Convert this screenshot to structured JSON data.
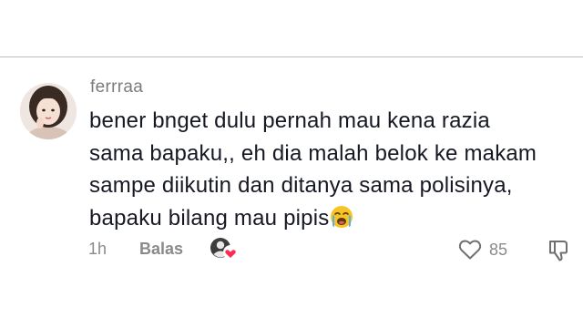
{
  "comment": {
    "username": "ferrraa",
    "text_lines": [
      "bener bnget dulu pernah mau kena razia",
      "sama bapaku,, eh dia malah belok ke makam",
      "sampe diikutin dan ditanya sama polisinya,",
      "bapaku bilang mau pipis"
    ],
    "emoji": "loudly-crying-face",
    "time": "1h",
    "reply_label": "Balas",
    "like_count": "85"
  },
  "icons": {
    "like": "heart-outline-icon",
    "dislike": "thumbs-down-icon",
    "creator_liked": "creator-liked-badge"
  },
  "colors": {
    "text": "#161823",
    "muted": "#8a8a8a",
    "heart_red": "#fe2c55"
  }
}
